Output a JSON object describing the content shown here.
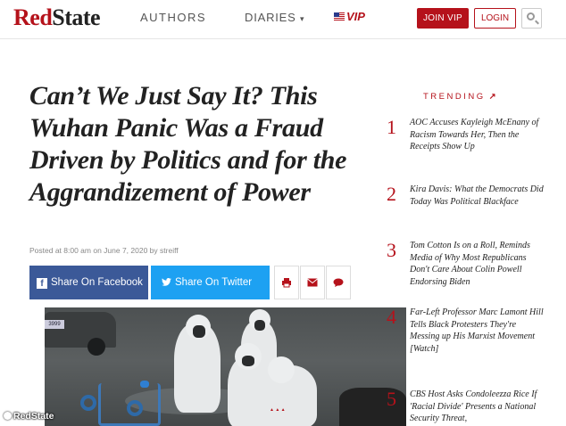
{
  "header": {
    "logo_red": "Red",
    "logo_dark": "State",
    "nav": {
      "authors": "AUTHORS",
      "diaries": "DIARIES",
      "diaries_caret": "▾",
      "vip": "VIP"
    },
    "join_label": "JOIN VIP",
    "login_label": "LOGIN"
  },
  "article": {
    "headline": "Can’t We Just Say It? This Wuhan Panic Was a Fraud Driven by Politics and for the Aggrandizement of Power",
    "meta": "Posted at 8:00 am on June 7, 2020 by streiff",
    "share_facebook": "Share On Facebook",
    "share_twitter": "Share On Twitter",
    "photo_plate": "3999"
  },
  "trending": {
    "title": "TRENDING",
    "items": [
      {
        "num": "1",
        "text": "AOC Accuses Kayleigh McEnany of Racism Towards Her, Then the Receipts Show Up"
      },
      {
        "num": "2",
        "text": "Kira Davis: What the Democrats Did Today Was Political Blackface"
      },
      {
        "num": "3",
        "text": "Tom Cotton Is on a Roll, Reminds Media of Why Most Republicans Don't Care About Colin Powell Endorsing Biden"
      },
      {
        "num": "4",
        "text": "Far-Left Professor Marc Lamont Hill Tells Black Protesters They're Messing up His Marxist Movement [Watch]"
      },
      {
        "num": "5",
        "text": "CBS Host Asks Condoleezza Rice If 'Racial Divide' Presents a National Security Threat,"
      }
    ]
  },
  "watermark": "RedState",
  "colors": {
    "brand_red": "#b5121b",
    "facebook": "#3b5998",
    "twitter": "#1da1f2"
  }
}
